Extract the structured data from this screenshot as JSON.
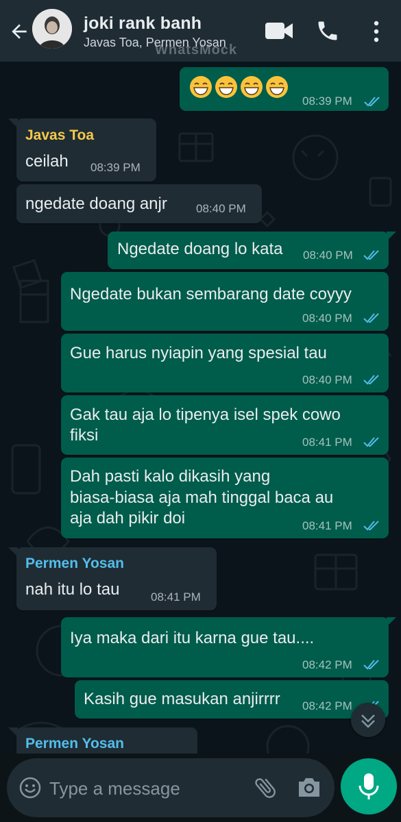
{
  "header": {
    "title": "joki rank banh",
    "participants": "Javas Toa, Permen Yosan",
    "watermark": "WhatsMock",
    "back_icon": "back-arrow-icon",
    "video_icon": "video-camera-icon",
    "call_icon": "phone-icon",
    "menu_icon": "more-vertical-icon"
  },
  "messages": [
    {
      "dir": "out",
      "text": "😁😁😁😁",
      "time": "08:39 PM",
      "status": "read"
    },
    {
      "dir": "in",
      "sender": "Javas Toa",
      "text": "ceilah",
      "time": "08:39 PM"
    },
    {
      "dir": "in",
      "text": "ngedate doang anjr",
      "time": "08:40 PM"
    },
    {
      "dir": "out",
      "text": "Ngedate doang lo kata",
      "time": "08:40 PM",
      "status": "read"
    },
    {
      "dir": "out",
      "text": "Ngedate bukan sembarang date coyyy",
      "time": "08:40 PM",
      "status": "read"
    },
    {
      "dir": "out",
      "text": "Gue harus nyiapin yang spesial tau",
      "time": "08:40 PM",
      "status": "read"
    },
    {
      "dir": "out",
      "lines": [
        "Gak tau aja lo tipenya isel spek cowo",
        "fiksi"
      ],
      "time": "08:41 PM",
      "status": "read"
    },
    {
      "dir": "out",
      "lines": [
        "Dah pasti kalo dikasih yang",
        "biasa-biasa aja mah tinggal baca au",
        "aja dah pikir doi"
      ],
      "time": "08:41 PM",
      "status": "read"
    },
    {
      "dir": "in",
      "sender": "Permen Yosan",
      "text": "nah itu lo tau",
      "time": "08:41 PM"
    },
    {
      "dir": "out",
      "text": "Iya maka dari itu karna gue tau....",
      "time": "08:42 PM",
      "status": "read"
    },
    {
      "dir": "out",
      "text": "Kasih gue masukan anjirrrr",
      "time": "08:42 PM",
      "status": "read"
    },
    {
      "dir": "in",
      "sender": "Permen Yosan",
      "text": "",
      "time": ""
    }
  ],
  "input": {
    "placeholder": "Type a message",
    "emoji_icon": "emoji-icon",
    "attach_icon": "paperclip-icon",
    "camera_icon": "camera-icon",
    "mic_icon": "microphone-icon"
  },
  "colors": {
    "header_bg": "#1f2c34",
    "chat_bg": "#0b141a",
    "outgoing_bubble": "#005c4b",
    "incoming_bubble": "#1f2c34",
    "sender_javas": "#f7c948",
    "sender_permen": "#53bdeb",
    "read_ticks": "#53bdeb",
    "mic_button": "#00a884"
  }
}
